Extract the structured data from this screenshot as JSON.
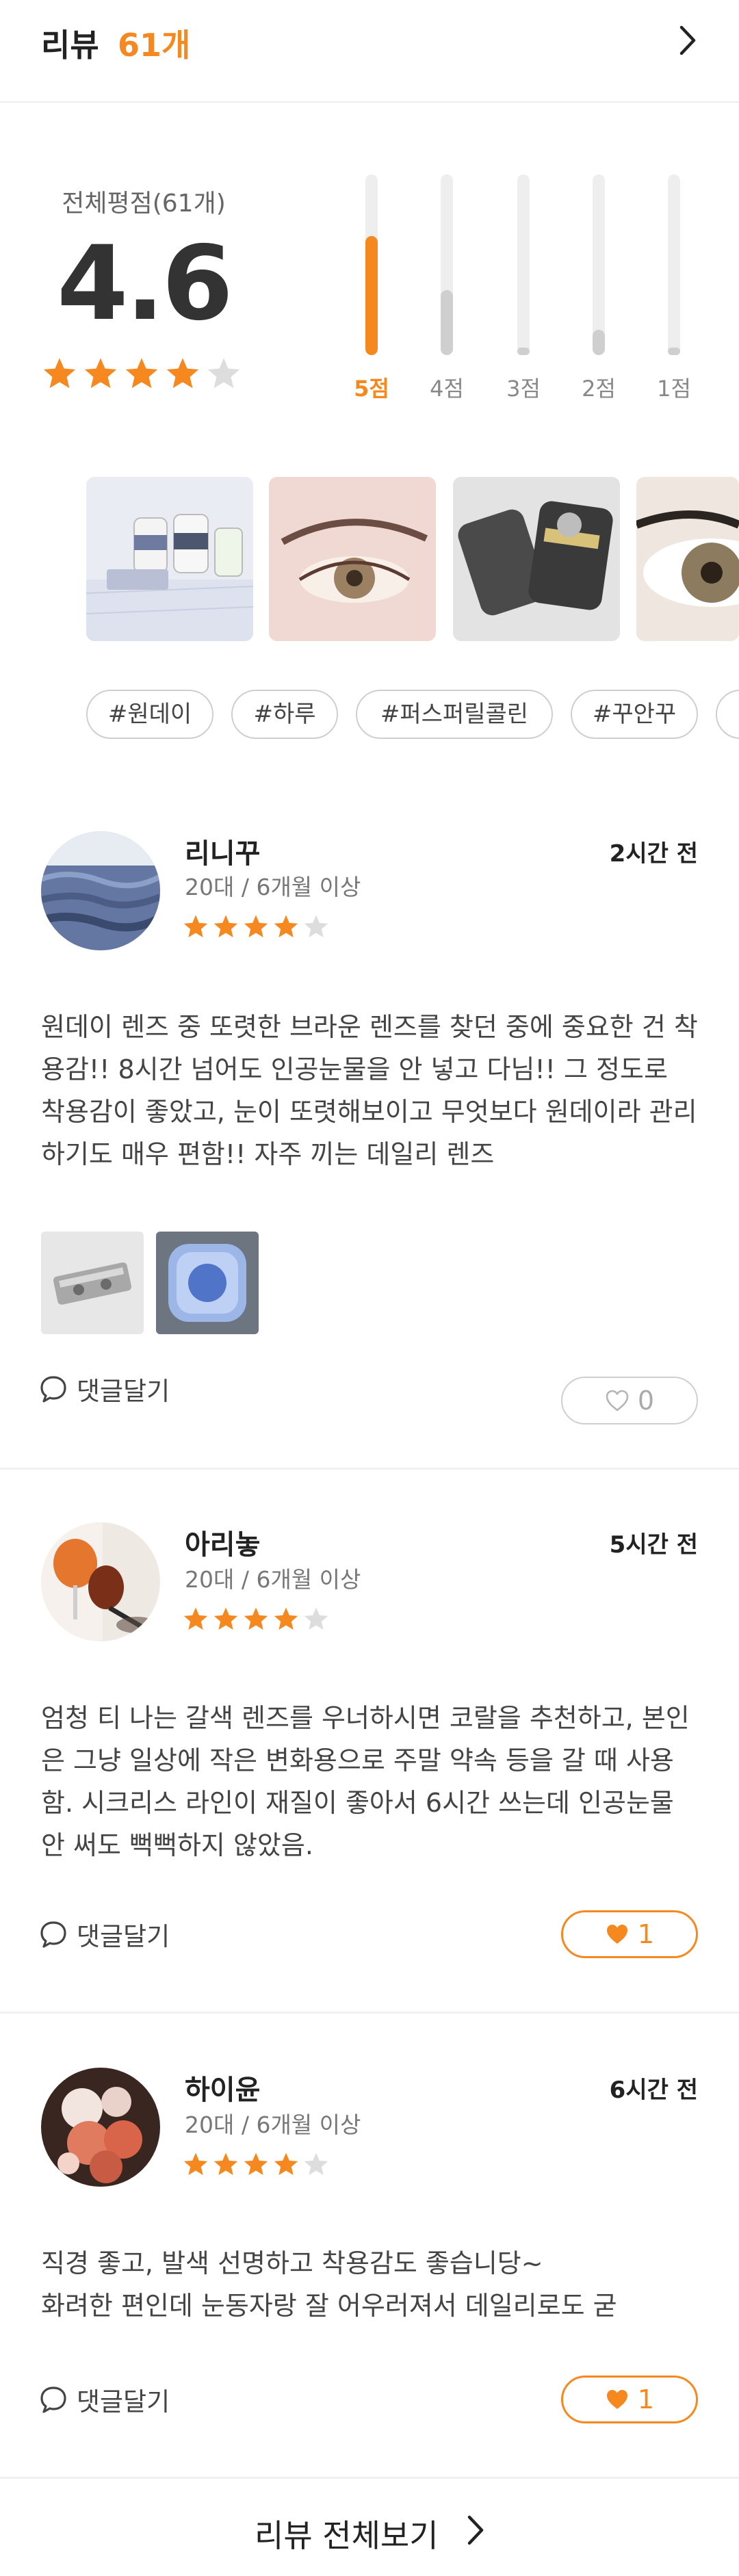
{
  "header": {
    "title": "리뷰",
    "count": "61개"
  },
  "summary": {
    "label": "전체평점(61개)",
    "score": "4.6",
    "stars": 4,
    "bars": [
      {
        "label": "5점",
        "fill": 0.66,
        "active": true
      },
      {
        "label": "4점",
        "fill": 0.36,
        "active": false
      },
      {
        "label": "3점",
        "fill": 0.04,
        "active": false
      },
      {
        "label": "2점",
        "fill": 0.14,
        "active": false
      },
      {
        "label": "1점",
        "fill": 0.04,
        "active": false
      }
    ]
  },
  "tags": [
    "#원데이",
    "#하루",
    "#퍼스퍼릴콜린",
    "#꾸안꾸"
  ],
  "reviews": [
    {
      "name": "리니꾸",
      "meta": "20대  /  6개월 이상",
      "time": "2시간 전",
      "stars": 4,
      "body": "원데이 렌즈 중 또렷한 브라운 렌즈를 찾던 중에 중요한 건 착용감!! 8시간 넘어도 인공눈물을 안 넣고 다님!! 그 정도로 착용감이 좋았고, 눈이 또렷해보이고 무엇보다 원데이라 관리하기도 매우 편함!! 자주 끼는 데일리 렌즈",
      "comment_label": "댓글달기",
      "likes": "0",
      "liked": false
    },
    {
      "name": "아리놓",
      "meta": "20대  /  6개월 이상",
      "time": "5시간 전",
      "stars": 4,
      "body": "엄청 티 나는 갈색 렌즈를 우너하시면 코랄을 추천하고, 본인은 그냥 일상에 작은 변화용으로 주말 약속 등을 갈 때 사용함. 시크리스 라인이 재질이 좋아서 6시간 쓰는데 인공눈물 안 써도 뻑뻑하지 않았음.",
      "comment_label": "댓글달기",
      "likes": "1",
      "liked": true
    },
    {
      "name": "하이윤",
      "meta": "20대  /  6개월 이상",
      "time": "6시간 전",
      "stars": 4,
      "body": "직경 좋고, 발색 선명하고 착용감도 좋습니당~\n 화려한 편인데 눈동자랑 잘 어우러져서 데일리로도 굳",
      "comment_label": "댓글달기",
      "likes": "1",
      "liked": true
    }
  ],
  "footer": {
    "label": "리뷰 전체보기"
  },
  "colors": {
    "accent": "#f5891f",
    "star_off": "#dddddd"
  }
}
